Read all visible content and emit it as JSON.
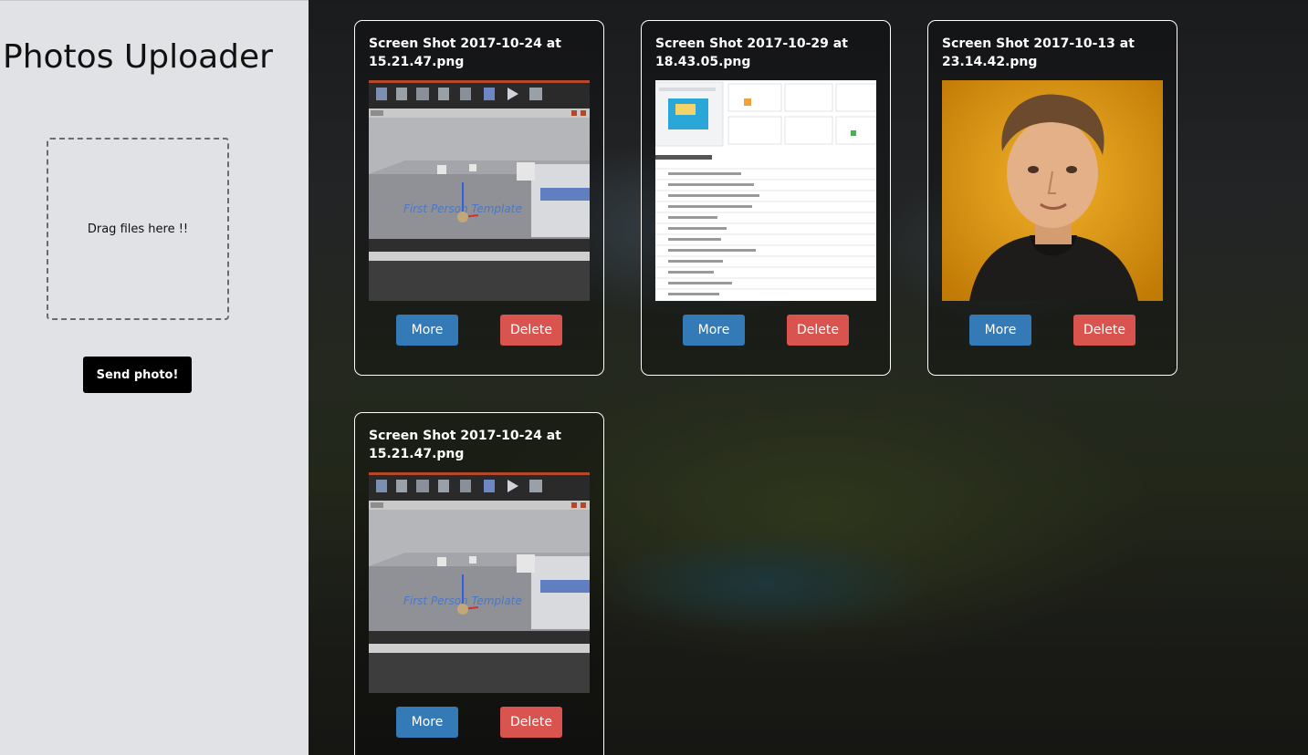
{
  "sidebar": {
    "title": "Photos Uploader",
    "dropzone_text": "Drag files here !!",
    "send_label": "Send photo!"
  },
  "photos": [
    {
      "title": "Screen Shot 2017-10-24 at 15.21.47.png",
      "thumb": "editor-screenshot",
      "more_label": "More",
      "delete_label": "Delete"
    },
    {
      "title": "Screen Shot 2017-10-29 at 18.43.05.png",
      "thumb": "performance-report-screenshot",
      "more_label": "More",
      "delete_label": "Delete"
    },
    {
      "title": "Screen Shot 2017-10-13 at 23.14.42.png",
      "thumb": "portrait-photo",
      "more_label": "More",
      "delete_label": "Delete"
    },
    {
      "title": "Screen Shot 2017-10-24 at 15.21.47.png",
      "thumb": "editor-screenshot",
      "more_label": "More",
      "delete_label": "Delete"
    }
  ],
  "colors": {
    "more_button": "#337ab7",
    "delete_button": "#d9534f",
    "sidebar_bg": "#e1e2e6",
    "send_button": "#000000"
  }
}
